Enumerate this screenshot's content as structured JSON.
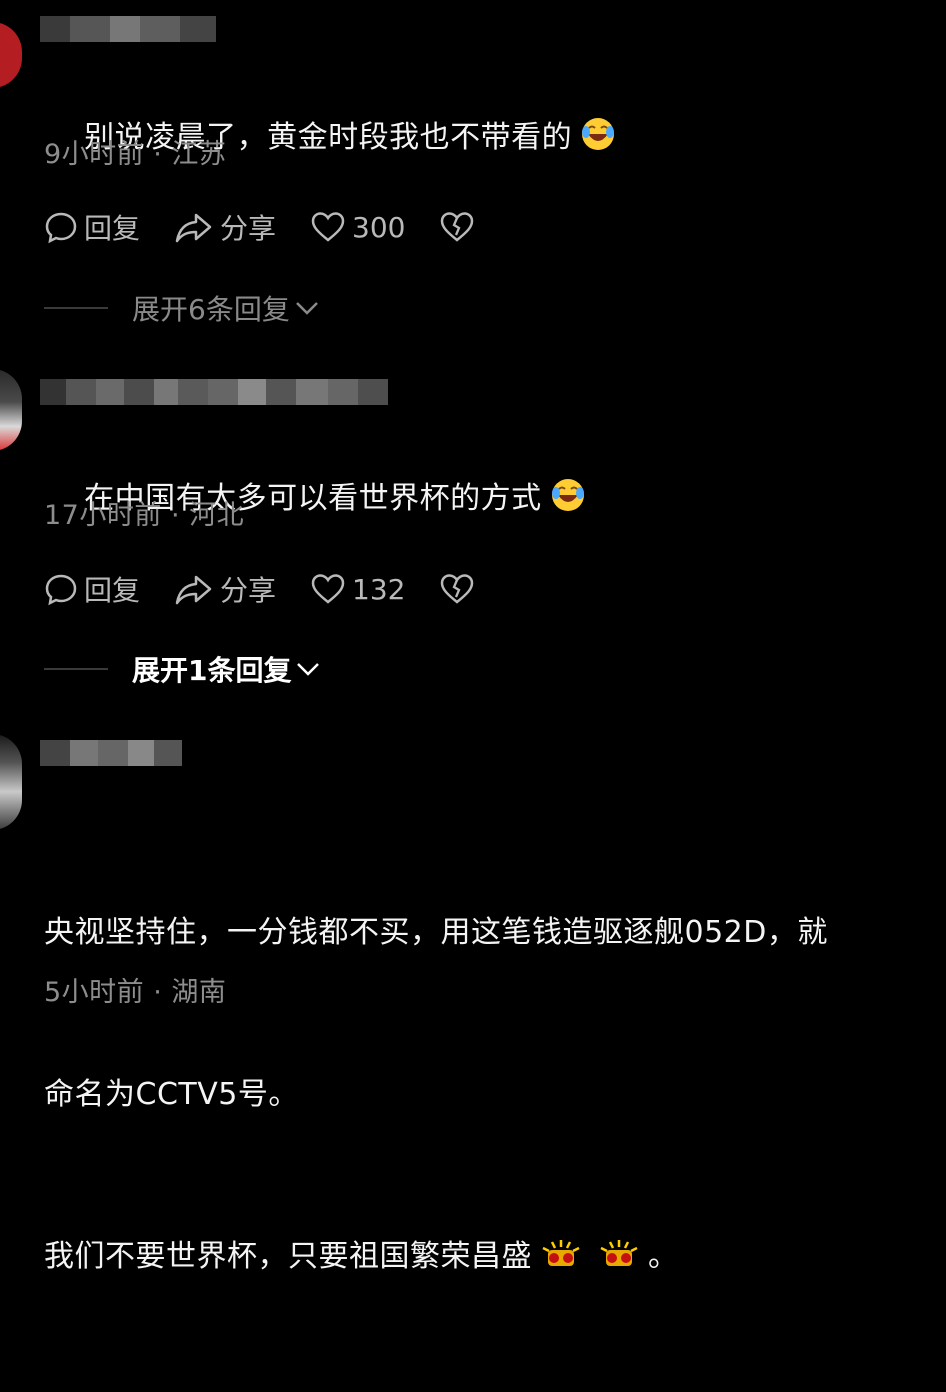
{
  "comments": [
    {
      "text": "别说凌晨了，黄金时段我也不带看的",
      "meta": "9小时前 · 江苏",
      "reply_label": "回复",
      "share_label": "分享",
      "likes": "300",
      "expand_label": "展开6条回复"
    },
    {
      "text": "在中国有太多可以看世界杯的方式",
      "meta": "17小时前 · 河北",
      "reply_label": "回复",
      "share_label": "分享",
      "likes": "132",
      "expand_label": "展开1条回复"
    },
    {
      "text_line1": "央视坚持住，一分钱都不买，用这笔钱造驱逐舰052D，就",
      "text_line2": "命名为CCTV5号。",
      "text_line3": "我们不要世界杯，只要祖国繁荣昌盛",
      "text_line3_end": "。",
      "meta": "5小时前 · 湖南"
    }
  ],
  "colors": {
    "background": "#000000",
    "text": "#f4f4f4",
    "meta": "#8d8d8d",
    "action": "#b9b9b9"
  },
  "icons": [
    "reply-bubble-icon",
    "share-arrow-icon",
    "heart-icon",
    "broken-heart-icon",
    "laugh-cry-emoji",
    "fireworks-emoji"
  ]
}
